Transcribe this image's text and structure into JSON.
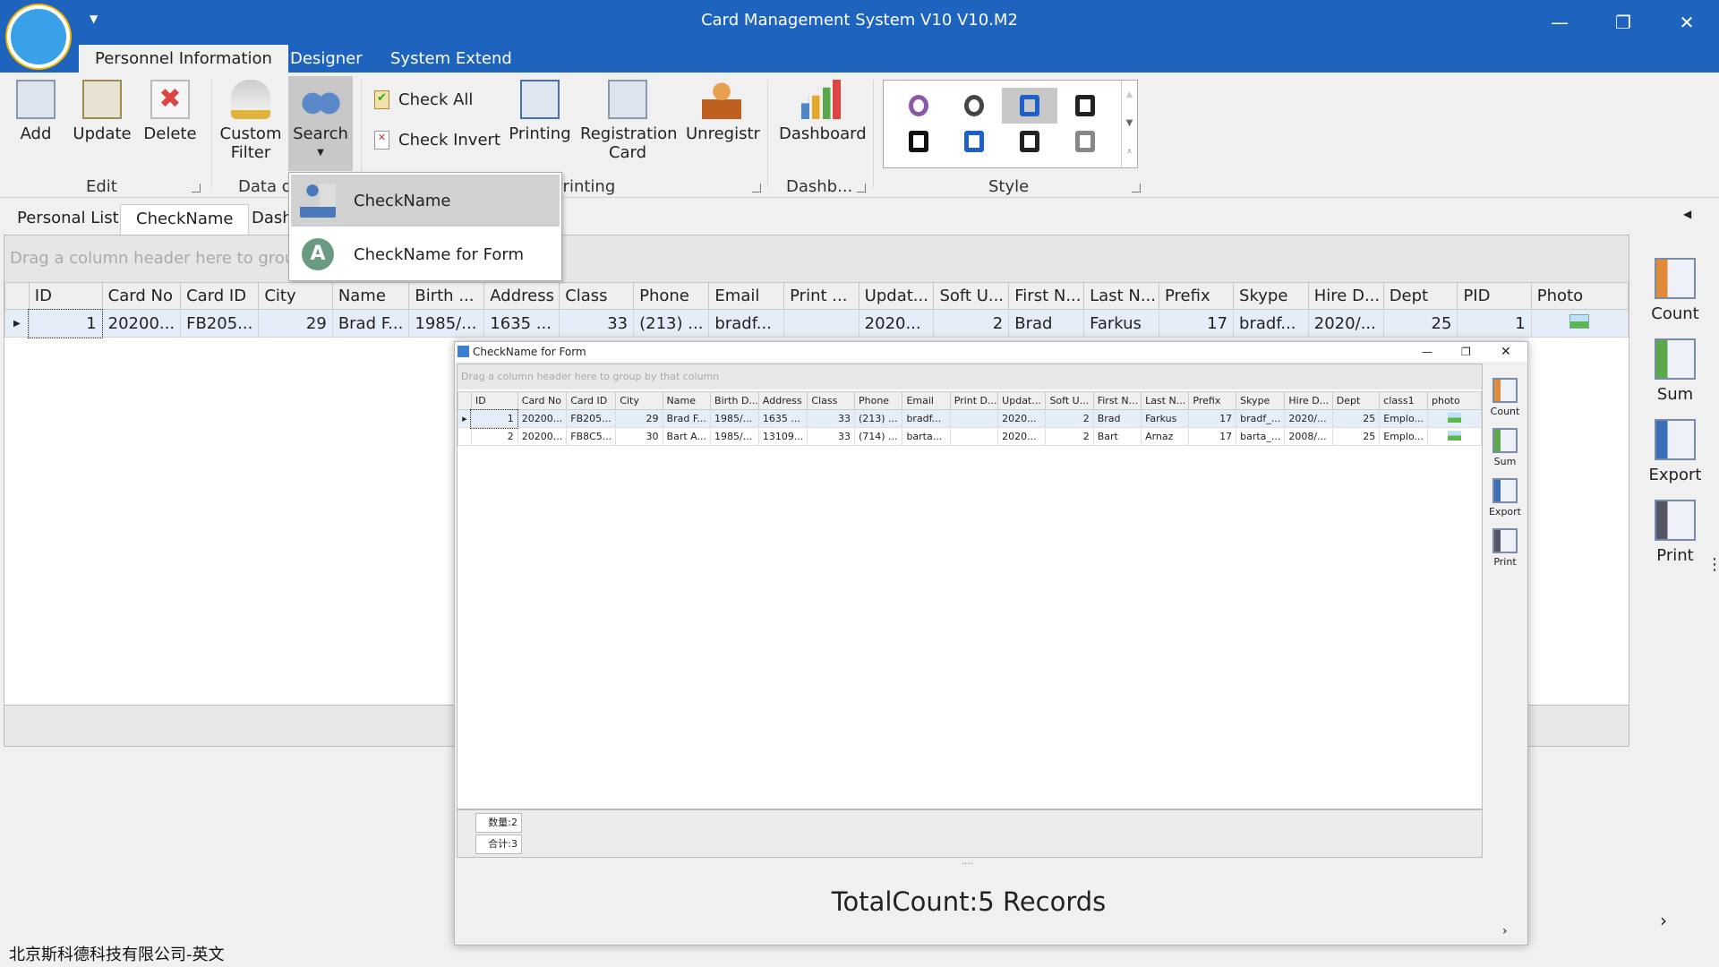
{
  "window": {
    "title": "Card Management System V10 V10.M2",
    "minimize": "—",
    "restore": "❐",
    "close": "✕"
  },
  "ribbon_tabs": [
    "Personnel Information",
    "Designer",
    "System Extend"
  ],
  "ribbon": {
    "edit": {
      "label": "Edit",
      "add": "Add",
      "update": "Update",
      "delete": "Delete"
    },
    "data_query": {
      "label": "Data q",
      "custom_filter_1": "Custom",
      "custom_filter_2": "Filter",
      "search": "Search"
    },
    "printing": {
      "label": "Printing",
      "check_all": "Check All",
      "check_invert": "Check Invert",
      "printing": "Printing",
      "registration_1": "Registration",
      "registration_2": "Card",
      "unregistr": "Unregistr"
    },
    "dashboard": {
      "label": "Dashb...",
      "dashboard": "Dashboard"
    },
    "style": {
      "label": "Style",
      "selected_index": 2
    }
  },
  "search_menu": [
    "CheckName",
    "CheckName for Form"
  ],
  "doc_tabs": [
    "Personal List",
    "CheckName",
    "Dash"
  ],
  "main_grid": {
    "group_hint": "Drag a column header here to group by that column",
    "columns": [
      "ID",
      "Card No",
      "Card ID",
      "City",
      "Name",
      "Birth ...",
      "Address",
      "Class",
      "Phone",
      "Email",
      "Print ...",
      "Updat...",
      "Soft U...",
      "First N...",
      "Last N...",
      "Prefix",
      "Skype",
      "Hire D...",
      "Dept",
      "PID",
      "Photo"
    ],
    "rows": [
      [
        "1",
        "20200...",
        "FB205...",
        "29",
        "Brad F...",
        "1985/...",
        "1635 ...",
        "33",
        "(213) ...",
        "bradf...",
        "",
        "2020...",
        "2",
        "Brad",
        "Farkus",
        "17",
        "bradf...",
        "2020/...",
        "25",
        "1",
        ""
      ]
    ]
  },
  "side_panel": [
    "Count",
    "Sum",
    "Export",
    "Print"
  ],
  "status": "北京斯科德科技有限公司-英文",
  "form": {
    "title": "CheckName for Form",
    "group_hint": "Drag a column header here to group by that column",
    "columns": [
      "ID",
      "Card No",
      "Card ID",
      "City",
      "Name",
      "Birth D...",
      "Address",
      "Class",
      "Phone",
      "Email",
      "Print D...",
      "Updat...",
      "Soft U...",
      "First N...",
      "Last N...",
      "Prefix",
      "Skype",
      "Hire D...",
      "Dept",
      "class1",
      "photo"
    ],
    "rows": [
      [
        "1",
        "20200...",
        "FB205...",
        "29",
        "Brad F...",
        "1985/...",
        "1635 ...",
        "33",
        "(213) ...",
        "bradf...",
        "",
        "2020...",
        "2",
        "Brad",
        "Farkus",
        "17",
        "bradf_...",
        "2020/...",
        "25",
        "Emplo...",
        ""
      ],
      [
        "2",
        "20200...",
        "FB8C5...",
        "30",
        "Bart A...",
        "1985/...",
        "13109...",
        "33",
        "(714) ...",
        "barta...",
        "",
        "2020...",
        "2",
        "Bart",
        "Arnaz",
        "17",
        "barta_...",
        "2008/...",
        "25",
        "Emplo...",
        ""
      ]
    ],
    "count_label": "数量:2",
    "sum_label": "合计:3",
    "side_panel": [
      "Count",
      "Sum",
      "Export",
      "Print"
    ],
    "total": "TotalCount:5 Records"
  },
  "colors": {
    "title_bar": "#1e63bd",
    "selected_row": "#e5eef8"
  }
}
